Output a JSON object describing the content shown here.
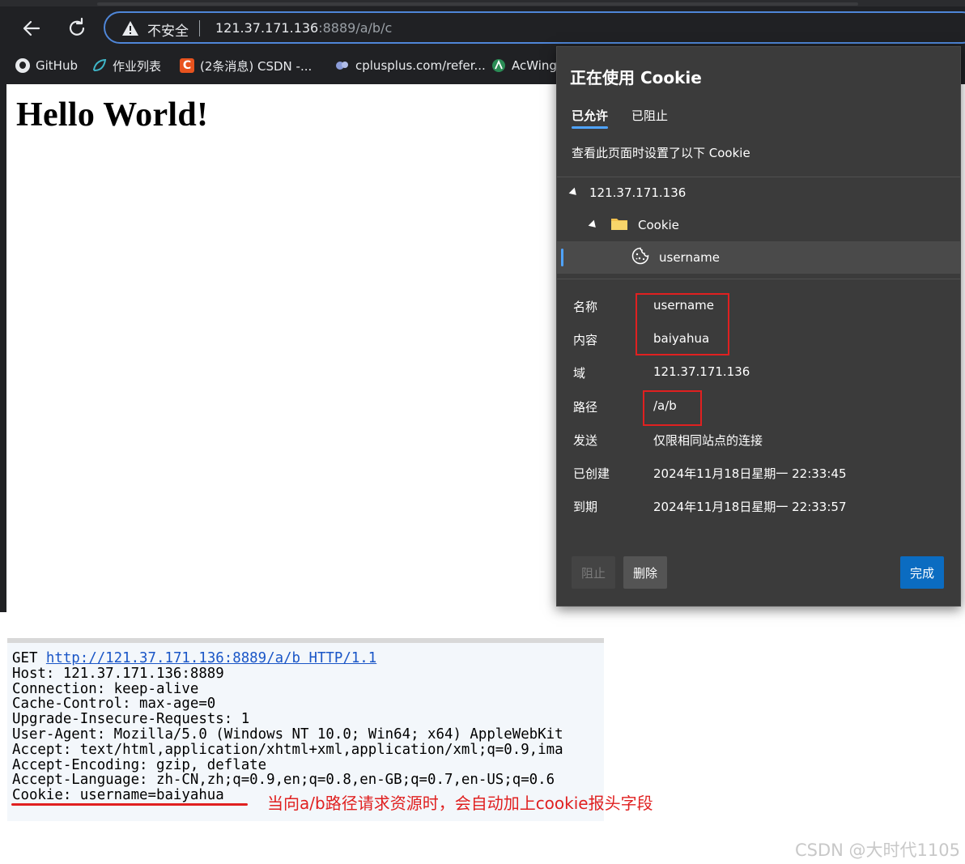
{
  "browser": {
    "insecure_label": "不安全",
    "url_host": "121.37.171.136",
    "url_rest": ":8889/a/b/c",
    "bookmarks": [
      {
        "label": "GitHub",
        "icon": "github-icon"
      },
      {
        "label": "作业列表",
        "icon": "leaf-icon"
      },
      {
        "label": "(2条消息) CSDN -...",
        "icon": "csdn-icon"
      },
      {
        "label": "cplusplus.com/refer...",
        "icon": "cplusplus-icon"
      },
      {
        "label": "AcWing",
        "icon": "acwing-icon"
      }
    ]
  },
  "page": {
    "heading": "Hello World!"
  },
  "cookie_dialog": {
    "title": "正在使用 Cookie",
    "tabs": {
      "allowed": "已允许",
      "blocked": "已阻止"
    },
    "description": "查看此页面时设置了以下 Cookie",
    "tree": {
      "site": "121.37.171.136",
      "folder": "Cookie",
      "cookie_name": "username"
    },
    "details": [
      {
        "label": "名称",
        "value": "username"
      },
      {
        "label": "内容",
        "value": "baiyahua"
      },
      {
        "label": "域",
        "value": "121.37.171.136"
      },
      {
        "label": "路径",
        "value": "/a/b"
      },
      {
        "label": "发送",
        "value": "仅限相同站点的连接"
      },
      {
        "label": "已创建",
        "value": "2024年11月18日星期一 22:33:45"
      },
      {
        "label": "到期",
        "value": "2024年11月18日星期一 22:33:57"
      }
    ],
    "buttons": {
      "block": "阻止",
      "delete": "删除",
      "done": "完成"
    }
  },
  "http_request": {
    "method": "GET ",
    "url": "http://121.37.171.136:8889/a/b",
    "version": " HTTP/1.1",
    "headers": [
      "Host: 121.37.171.136:8889",
      "Connection: keep-alive",
      "Cache-Control: max-age=0",
      "Upgrade-Insecure-Requests: 1",
      "User-Agent: Mozilla/5.0 (Windows NT 10.0; Win64; x64) AppleWebKit",
      "Accept: text/html,application/xhtml+xml,application/xml;q=0.9,ima",
      "Accept-Encoding: gzip, deflate",
      "Accept-Language: zh-CN,zh;q=0.9,en;q=0.8,en-GB;q=0.7,en-US;q=0.6",
      "Cookie: username=baiyahua"
    ]
  },
  "annotation": "当向a/b路径请求资源时，会自动加上cookie报头字段",
  "watermark": "CSDN @大时代1105"
}
